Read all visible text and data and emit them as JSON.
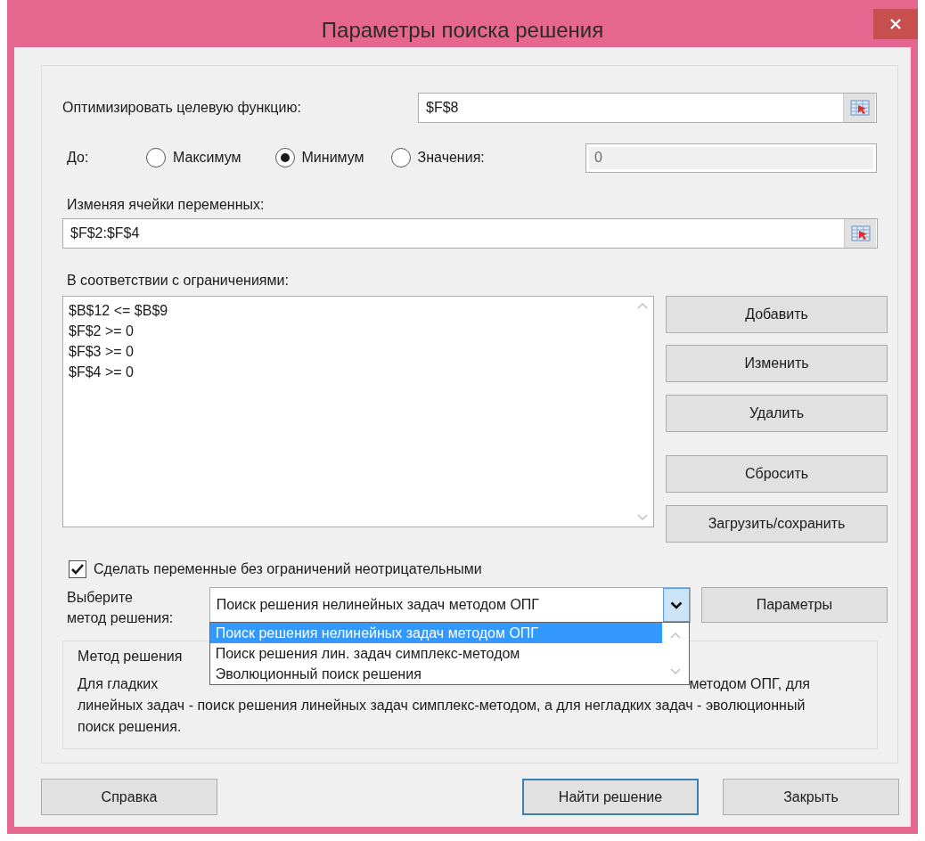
{
  "window": {
    "title": "Параметры поиска решения"
  },
  "objective": {
    "label": "Оптимизировать целевую функцию:",
    "value": "$F$8"
  },
  "target": {
    "label": "До:",
    "options": [
      {
        "label": "Максимум",
        "selected": false
      },
      {
        "label": "Минимум",
        "selected": true
      },
      {
        "label": "Значения:",
        "selected": false
      }
    ],
    "value_field": {
      "value": "0",
      "disabled": true
    }
  },
  "variables": {
    "label": "Изменяя ячейки переменных:",
    "value": "$F$2:$F$4"
  },
  "constraints": {
    "label": "В соответствии с ограничениями:",
    "items": [
      "$B$12 <= $B$9",
      "$F$2 >= 0",
      "$F$3 >= 0",
      "$F$4 >= 0"
    ]
  },
  "constraint_buttons": [
    "Добавить",
    "Изменить",
    "Удалить",
    "Сбросить",
    "Загрузить/сохранить"
  ],
  "nonnegative": {
    "label": "Сделать переменные без ограничений неотрицательными",
    "checked": true
  },
  "method": {
    "label": "Выберите метод решения:",
    "value": "Поиск решения нелинейных задач методом ОПГ",
    "expanded": true,
    "options": [
      {
        "label": "Поиск решения нелинейных задач методом ОПГ",
        "selected": true
      },
      {
        "label": "Поиск решения лин. задач симплекс-методом",
        "selected": false
      },
      {
        "label": "Эволюционный поиск решения",
        "selected": false
      }
    ]
  },
  "parameters_button": "Параметры",
  "method_description": {
    "title": "Метод решения",
    "text_parts": [
      "Для гладких",
      "методом ОПГ, для",
      "линейных задач - поиск решения линейных задач симплекс-методом, а для негладких задач - эволюционный поиск решения."
    ]
  },
  "buttons": [
    {
      "label": "Справка",
      "default": false
    },
    {
      "label": "Найти решение",
      "default": true
    },
    {
      "label": "Закрыть",
      "default": false
    }
  ]
}
